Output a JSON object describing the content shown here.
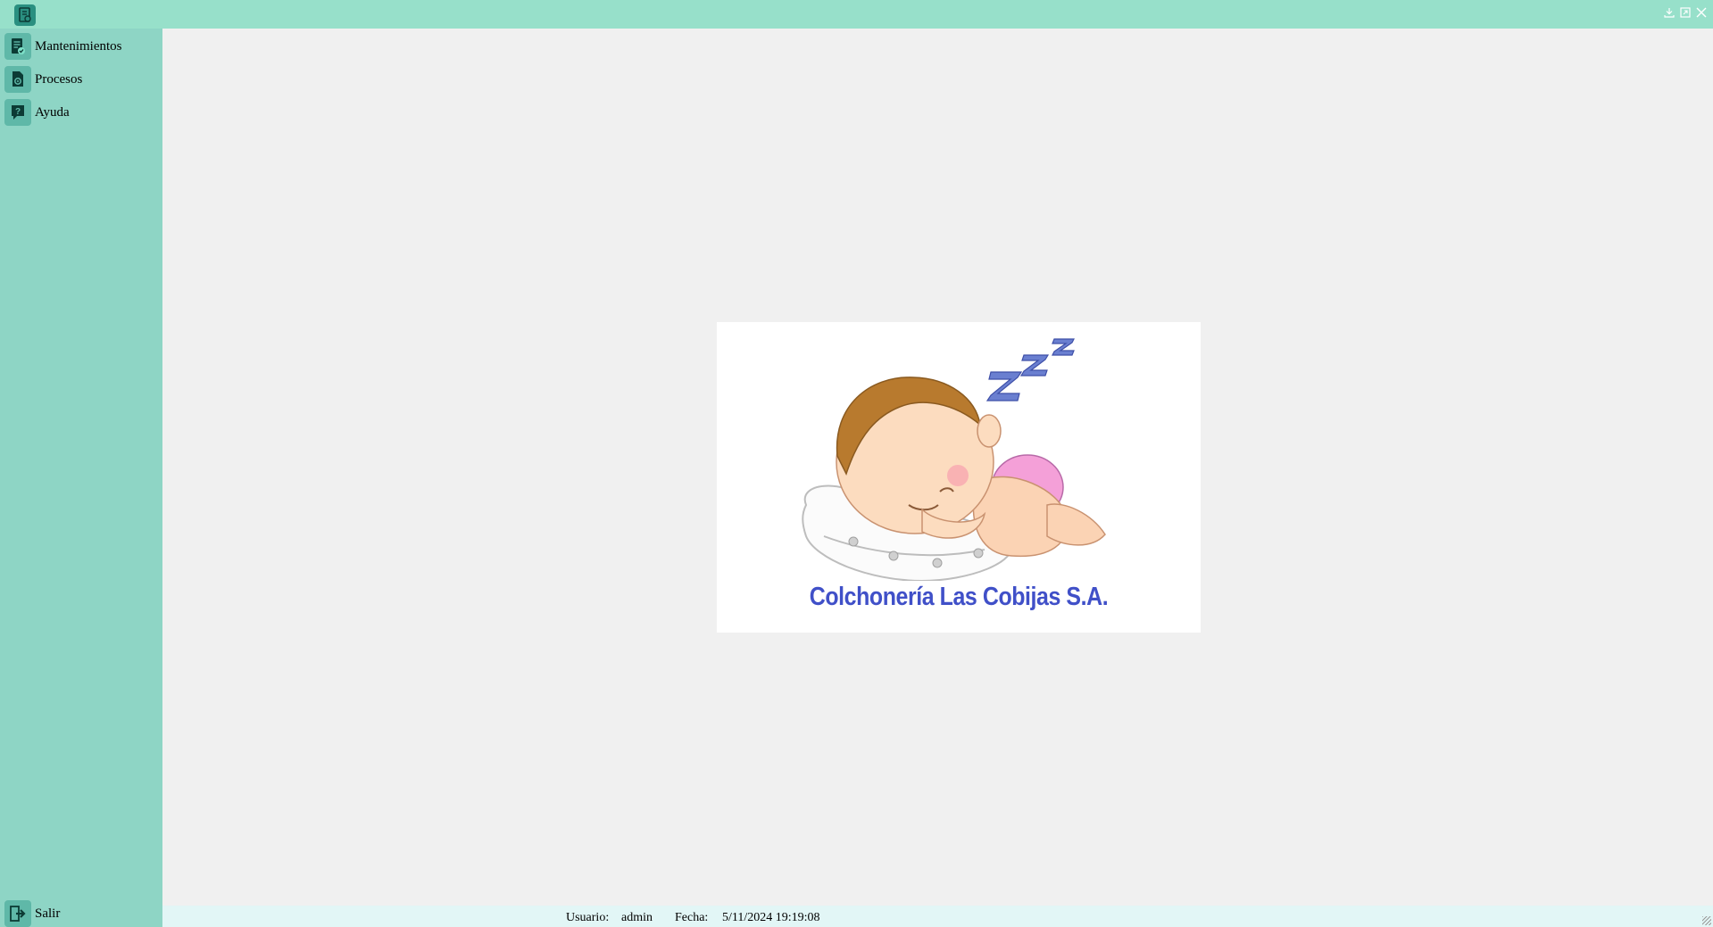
{
  "window": {
    "app_icon": "document-gear-icon",
    "controls": [
      "minimize-icon",
      "maximize-icon",
      "close-icon"
    ]
  },
  "sidebar": {
    "items": [
      {
        "label": "Mantenimientos",
        "icon": "document-check-icon"
      },
      {
        "label": "Procesos",
        "icon": "document-gear-icon"
      },
      {
        "label": "Ayuda",
        "icon": "help-icon"
      }
    ],
    "exit": {
      "label": "Salir",
      "icon": "exit-icon"
    }
  },
  "logo": {
    "caption": "Colchonería Las Cobijas S.A.",
    "sleep_text": "Z Z Z"
  },
  "status": {
    "user_label": "Usuario:",
    "user_value": "admin",
    "date_label": "Fecha:",
    "date_value": "5/11/2024 19:19:08"
  },
  "colors": {
    "titlebar": "#97e0ca",
    "sidebar": "#8ed5c5",
    "icon_bg": "#5fb8a8",
    "caption": "#4050c8"
  }
}
